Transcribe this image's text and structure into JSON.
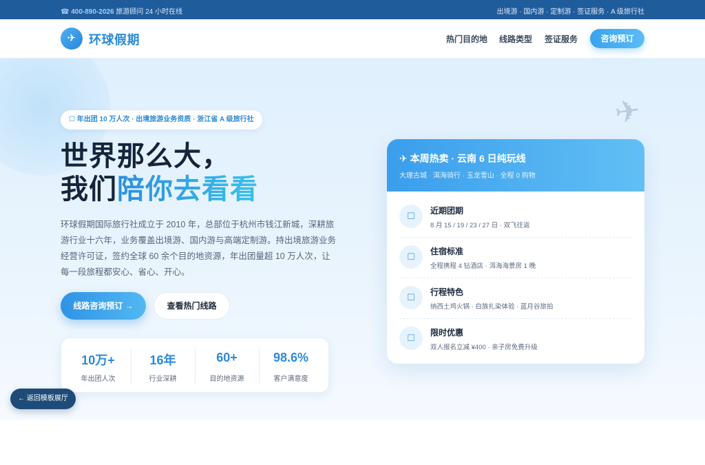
{
  "topbar": {
    "phone": "☎ 400-890-2026",
    "phone_note": " 旅游顾问 24 小时在线",
    "links": "出境游 · 国内游 · 定制游 · 签证服务 · A 级旅行社"
  },
  "nav": {
    "logo_icon": "plane-icon",
    "logo_glyph": "✈",
    "brand": "环球假期",
    "links": [
      "热门目的地",
      "线路类型",
      "签证服务"
    ],
    "cta": "咨询预订"
  },
  "hero": {
    "deco_glyph": "✈",
    "badge": "☐ 年出团 10 万人次 · 出境旅游业务资质 · 浙江省 A 级旅行社",
    "headline_line1": "世界那么大，",
    "headline_line2_prefix": "我们",
    "headline_line2_accent": "陪你去看看",
    "description": "环球假期国际旅行社成立于 2010 年，总部位于杭州市钱江新城，深耕旅游行业十六年，业务覆盖出境游、国内游与高端定制游。持出境旅游业务经营许可证，签约全球 60 余个目的地资源，年出团量超 10 万人次，让每一段旅程都安心、省心、开心。",
    "primary_button": "线路咨询预订 →",
    "secondary_button": "查看热门线路",
    "stats": [
      {
        "value": "10万+",
        "label": "年出团人次"
      },
      {
        "value": "16年",
        "label": "行业深耕"
      },
      {
        "value": "60+",
        "label": "目的地资源"
      },
      {
        "value": "98.6%",
        "label": "客户满意度"
      }
    ]
  },
  "card": {
    "title": "✈ 本周热卖 · 云南 6 日纯玩线",
    "subtitle": "大理古城 · 洱海骑行 · 玉龙雪山 · 全程 0 购物",
    "items": [
      {
        "icon": "☐",
        "title": "近期团期",
        "detail": "8 月 15 / 19 / 23 / 27 日 · 双飞往返"
      },
      {
        "icon": "☐",
        "title": "住宿标准",
        "detail": "全程携程 4 钻酒店 · 洱海海景房 1 晚"
      },
      {
        "icon": "☐",
        "title": "行程特色",
        "detail": "纳西土鸡火锅 · 白族扎染体验 · 蓝月谷旅拍"
      },
      {
        "icon": "☐",
        "title": "限时优惠",
        "detail": "双人报名立减 ¥400 · 亲子房免费升级"
      }
    ]
  },
  "back_button": "← 返回模板展厅",
  "colors": {
    "topbar": "#1f5c9c",
    "accent": "#2a8ad8",
    "hero_bg": "#e3f1fd",
    "back_button": "#1f4b78"
  }
}
